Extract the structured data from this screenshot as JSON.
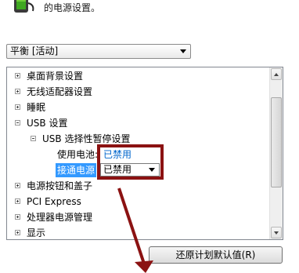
{
  "header": {
    "text": "的电源设置。",
    "icon": "battery-plug-icon"
  },
  "plan_select": {
    "value": "平衡 [活动]"
  },
  "tree": {
    "items": [
      {
        "label": "桌面背景设置",
        "expander": "plus"
      },
      {
        "label": "无线适配器设置",
        "expander": "plus"
      },
      {
        "label": "睡眠",
        "expander": "plus"
      },
      {
        "label": "USB 设置",
        "expander": "minus"
      },
      {
        "label": "USB 选择性暂停设置",
        "expander": "minus"
      },
      {
        "label": "使用电池:",
        "value": "已禁用"
      },
      {
        "label": "接通电源",
        "value": "已禁用"
      },
      {
        "label": "电源按钮和盖子",
        "expander": "plus"
      },
      {
        "label": "PCI Express",
        "expander": "plus"
      },
      {
        "label": "处理器电源管理",
        "expander": "plus"
      },
      {
        "label": "显示",
        "expander": "plus"
      }
    ]
  },
  "restore_button": {
    "label": "还原计划默认值(R)"
  },
  "colors": {
    "selection": "#3399ff",
    "link": "#0066cc",
    "annotation": "#8b1212"
  }
}
